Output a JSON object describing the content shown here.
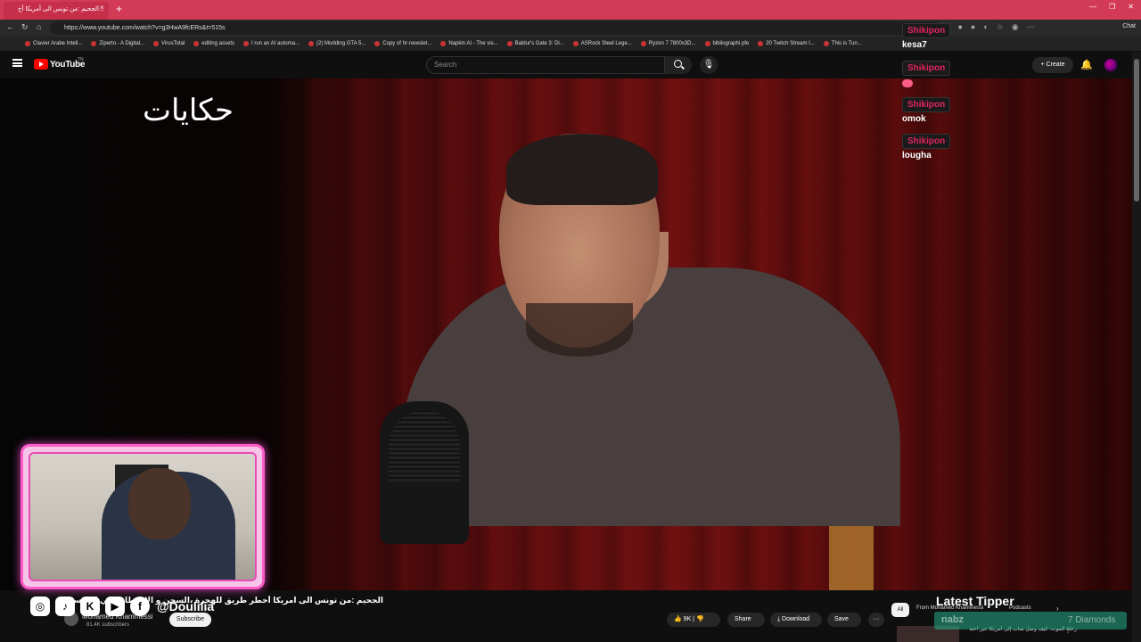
{
  "browser": {
    "tab_title": "الجحيم :من تونس الى أمريكا أخ...",
    "tab_close": "×",
    "new_tab": "+",
    "window_controls": [
      "—",
      "❐",
      "✕"
    ],
    "url": "https://www.youtube.com/watch?v=g3HwA9fcERs&t=515s",
    "chat_label": "Chat",
    "bookmarks": [
      "Clavier Arabe Intell...",
      "Ziperto - A Digital...",
      "VirusTotal",
      "editing assets",
      "I run an AI automa...",
      "(2) Modding GTA 5...",
      "Copy of hr-newslet...",
      "Napkin AI - The vis...",
      "Baldur's Gate 3: Di...",
      "ASRock Steel Lege...",
      "Ryzen 7 7800x3D...",
      "bibliographi pfe",
      "20 Twitch Stream I...",
      "This is Tun..."
    ]
  },
  "youtube": {
    "brand": "YouTube",
    "region": "TN",
    "search_placeholder": "Search",
    "create_label": "Create",
    "video_logo": "حكايات",
    "video_title": "الجحيم :من تونس الى امريكا أخطر طريق للهجرة ،السجن و الإختطاف في المكسيك مع المافيا، حكايات...",
    "channel_name": "Mohamed Khammessi",
    "channel_subs": "81.4K subscribers",
    "subscribe_label": "Subscribe",
    "like_count": "9K",
    "share_label": "Share",
    "download_label": "Download",
    "save_label": "Save",
    "more_label": "···",
    "chips": {
      "all": "All",
      "from": "From Mohamed Khammessi",
      "podcasts": "Podcasts",
      "next": "›"
    },
    "reco_text": "رحلة الموت: كيف وصل شاب إلى أمريكا عبر أخطر طرق الهجرة",
    "reco_more": "⋮"
  },
  "overlay": {
    "social_handle": "@Doulilia",
    "latest_tipper_title": "Latest Tipper",
    "tipper_name": "nabz",
    "tipper_amount": "7 Diamonds",
    "chat": [
      {
        "user": "Shikipon",
        "text": "kesa7"
      },
      {
        "user": "Shikipon",
        "text": ""
      },
      {
        "user": "Shikipon",
        "text": "omok"
      },
      {
        "user": "Shikipon",
        "text": "lougha"
      }
    ]
  },
  "colors": {
    "tab_bar": "#d33a55",
    "facecam_border": "#ff5cc8",
    "chat_user": "#e0245e",
    "youtube_red": "#ff0000"
  }
}
